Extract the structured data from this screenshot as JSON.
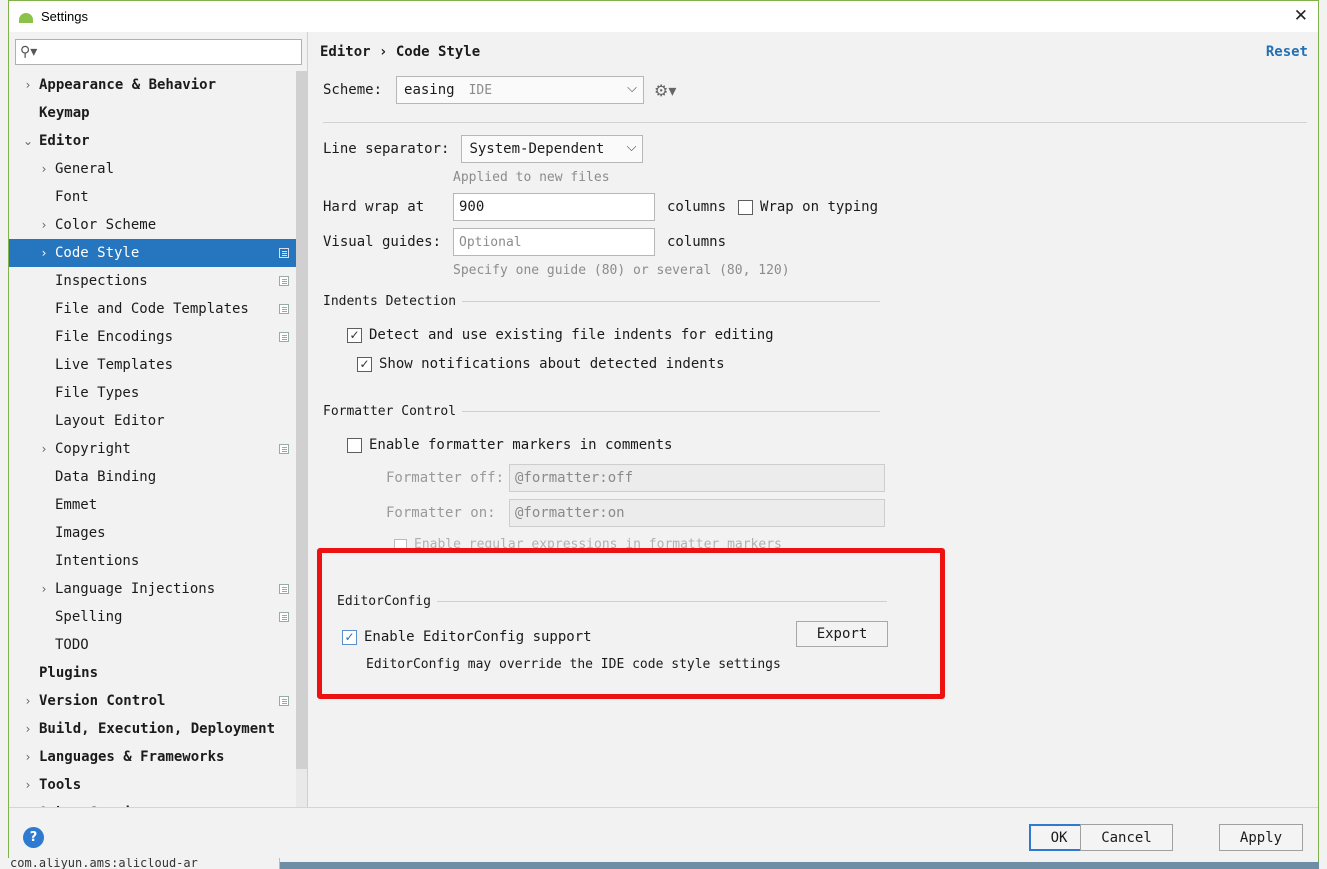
{
  "window": {
    "title": "Settings"
  },
  "bg": {
    "status_text": "com.aliyun.ams:alicloud-ar"
  },
  "sidebar": {
    "search_placeholder": "",
    "items": [
      {
        "label": "Appearance & Behavior",
        "level": 0,
        "arrow": "›",
        "bold": true
      },
      {
        "label": "Keymap",
        "level": 0,
        "bold": true
      },
      {
        "label": "Editor",
        "level": 0,
        "arrow": "⌄",
        "bold": true
      },
      {
        "label": "General",
        "level": 1,
        "arrow": "›"
      },
      {
        "label": "Font",
        "level": 1
      },
      {
        "label": "Color Scheme",
        "level": 1,
        "arrow": "›"
      },
      {
        "label": "Code Style",
        "level": 1,
        "arrow": "›",
        "selected": true,
        "icon": true
      },
      {
        "label": "Inspections",
        "level": 1,
        "icon": true
      },
      {
        "label": "File and Code Templates",
        "level": 1,
        "icon": true
      },
      {
        "label": "File Encodings",
        "level": 1,
        "icon": true
      },
      {
        "label": "Live Templates",
        "level": 1
      },
      {
        "label": "File Types",
        "level": 1
      },
      {
        "label": "Layout Editor",
        "level": 1
      },
      {
        "label": "Copyright",
        "level": 1,
        "arrow": "›",
        "icon": true
      },
      {
        "label": "Data Binding",
        "level": 1
      },
      {
        "label": "Emmet",
        "level": 1
      },
      {
        "label": "Images",
        "level": 1
      },
      {
        "label": "Intentions",
        "level": 1
      },
      {
        "label": "Language Injections",
        "level": 1,
        "arrow": "›",
        "icon": true
      },
      {
        "label": "Spelling",
        "level": 1,
        "icon": true
      },
      {
        "label": "TODO",
        "level": 1
      },
      {
        "label": "Plugins",
        "level": 0,
        "bold": true
      },
      {
        "label": "Version Control",
        "level": 0,
        "arrow": "›",
        "bold": true,
        "icon": true
      },
      {
        "label": "Build, Execution, Deployment",
        "level": 0,
        "arrow": "›",
        "bold": true
      },
      {
        "label": "Languages & Frameworks",
        "level": 0,
        "arrow": "›",
        "bold": true
      },
      {
        "label": "Tools",
        "level": 0,
        "arrow": "›",
        "bold": true
      },
      {
        "label": "Other Settings",
        "level": 0,
        "arrow": "›",
        "bold": true,
        "icon": true
      }
    ]
  },
  "main": {
    "breadcrumb": "Editor › Code Style",
    "reset_label": "Reset",
    "scheme_label": "Scheme:",
    "scheme_value": "easing",
    "scheme_type": "IDE",
    "line_separator_label": "Line separator:",
    "line_separator_value": "System-Dependent",
    "applied_hint": "Applied to new files",
    "hard_wrap_label": "Hard wrap at",
    "hard_wrap_value": "900",
    "columns_label": "columns",
    "wrap_on_typing_label": "Wrap on typing",
    "visual_guides_label": "Visual guides:",
    "visual_guides_placeholder": "Optional",
    "visual_guides_columns": "columns",
    "guides_hint": "Specify one guide (80) or several (80, 120)",
    "indents_title": "Indents Detection",
    "detect_indents_label": "Detect and use existing file indents for editing",
    "detect_indents_checked": true,
    "show_notifications_label": "Show notifications about detected indents",
    "show_notifications_checked": true,
    "formatter_title": "Formatter Control",
    "enable_markers_label": "Enable formatter markers in comments",
    "enable_markers_checked": false,
    "formatter_off_label": "Formatter off:",
    "formatter_off_value": "@formatter:off",
    "formatter_on_label": "Formatter on:",
    "formatter_on_value": "@formatter:on",
    "regex_label": "Enable regular expressions in formatter markers",
    "editorconfig_title": "EditorConfig",
    "editorconfig_enable_label": "Enable EditorConfig support",
    "editorconfig_enabled": true,
    "export_label": "Export",
    "editorconfig_hint": "EditorConfig may override the IDE code style settings"
  },
  "footer": {
    "help_label": "?",
    "ok_label": "OK",
    "cancel_label": "Cancel",
    "apply_label": "Apply"
  },
  "colors": {
    "selection": "#2675bf",
    "link": "#2470b3",
    "highlight_box": "#ee1111"
  }
}
